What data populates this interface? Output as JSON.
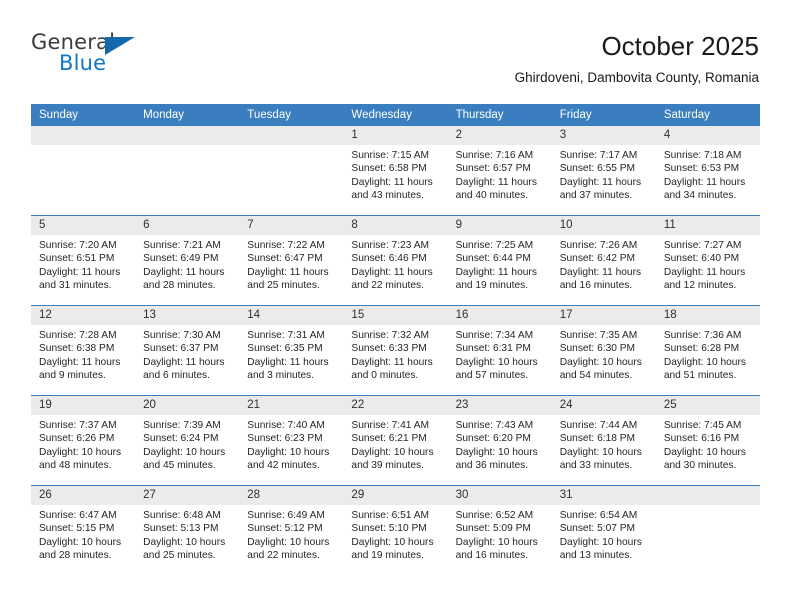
{
  "brand": {
    "line1": "General",
    "line2": "Blue",
    "triangle_icon": "brand-triangle-icon",
    "accent_color": "#1369ab"
  },
  "header": {
    "title": "October 2025",
    "subtitle": "Ghirdoveni, Dambovita County, Romania"
  },
  "theme": {
    "header_row_bg": "#3a7ec0",
    "daynum_bg": "#ebebeb",
    "row_divider": "#3a7ec0"
  },
  "weekday_headers": [
    "Sunday",
    "Monday",
    "Tuesday",
    "Wednesday",
    "Thursday",
    "Friday",
    "Saturday"
  ],
  "weeks": [
    [
      {
        "day": "",
        "sunrise": "",
        "sunset": "",
        "daylight_a": "",
        "daylight_b": ""
      },
      {
        "day": "",
        "sunrise": "",
        "sunset": "",
        "daylight_a": "",
        "daylight_b": ""
      },
      {
        "day": "",
        "sunrise": "",
        "sunset": "",
        "daylight_a": "",
        "daylight_b": ""
      },
      {
        "day": "1",
        "sunrise": "Sunrise: 7:15 AM",
        "sunset": "Sunset: 6:58 PM",
        "daylight_a": "Daylight: 11 hours",
        "daylight_b": "and 43 minutes."
      },
      {
        "day": "2",
        "sunrise": "Sunrise: 7:16 AM",
        "sunset": "Sunset: 6:57 PM",
        "daylight_a": "Daylight: 11 hours",
        "daylight_b": "and 40 minutes."
      },
      {
        "day": "3",
        "sunrise": "Sunrise: 7:17 AM",
        "sunset": "Sunset: 6:55 PM",
        "daylight_a": "Daylight: 11 hours",
        "daylight_b": "and 37 minutes."
      },
      {
        "day": "4",
        "sunrise": "Sunrise: 7:18 AM",
        "sunset": "Sunset: 6:53 PM",
        "daylight_a": "Daylight: 11 hours",
        "daylight_b": "and 34 minutes."
      }
    ],
    [
      {
        "day": "5",
        "sunrise": "Sunrise: 7:20 AM",
        "sunset": "Sunset: 6:51 PM",
        "daylight_a": "Daylight: 11 hours",
        "daylight_b": "and 31 minutes."
      },
      {
        "day": "6",
        "sunrise": "Sunrise: 7:21 AM",
        "sunset": "Sunset: 6:49 PM",
        "daylight_a": "Daylight: 11 hours",
        "daylight_b": "and 28 minutes."
      },
      {
        "day": "7",
        "sunrise": "Sunrise: 7:22 AM",
        "sunset": "Sunset: 6:47 PM",
        "daylight_a": "Daylight: 11 hours",
        "daylight_b": "and 25 minutes."
      },
      {
        "day": "8",
        "sunrise": "Sunrise: 7:23 AM",
        "sunset": "Sunset: 6:46 PM",
        "daylight_a": "Daylight: 11 hours",
        "daylight_b": "and 22 minutes."
      },
      {
        "day": "9",
        "sunrise": "Sunrise: 7:25 AM",
        "sunset": "Sunset: 6:44 PM",
        "daylight_a": "Daylight: 11 hours",
        "daylight_b": "and 19 minutes."
      },
      {
        "day": "10",
        "sunrise": "Sunrise: 7:26 AM",
        "sunset": "Sunset: 6:42 PM",
        "daylight_a": "Daylight: 11 hours",
        "daylight_b": "and 16 minutes."
      },
      {
        "day": "11",
        "sunrise": "Sunrise: 7:27 AM",
        "sunset": "Sunset: 6:40 PM",
        "daylight_a": "Daylight: 11 hours",
        "daylight_b": "and 12 minutes."
      }
    ],
    [
      {
        "day": "12",
        "sunrise": "Sunrise: 7:28 AM",
        "sunset": "Sunset: 6:38 PM",
        "daylight_a": "Daylight: 11 hours",
        "daylight_b": "and 9 minutes."
      },
      {
        "day": "13",
        "sunrise": "Sunrise: 7:30 AM",
        "sunset": "Sunset: 6:37 PM",
        "daylight_a": "Daylight: 11 hours",
        "daylight_b": "and 6 minutes."
      },
      {
        "day": "14",
        "sunrise": "Sunrise: 7:31 AM",
        "sunset": "Sunset: 6:35 PM",
        "daylight_a": "Daylight: 11 hours",
        "daylight_b": "and 3 minutes."
      },
      {
        "day": "15",
        "sunrise": "Sunrise: 7:32 AM",
        "sunset": "Sunset: 6:33 PM",
        "daylight_a": "Daylight: 11 hours",
        "daylight_b": "and 0 minutes."
      },
      {
        "day": "16",
        "sunrise": "Sunrise: 7:34 AM",
        "sunset": "Sunset: 6:31 PM",
        "daylight_a": "Daylight: 10 hours",
        "daylight_b": "and 57 minutes."
      },
      {
        "day": "17",
        "sunrise": "Sunrise: 7:35 AM",
        "sunset": "Sunset: 6:30 PM",
        "daylight_a": "Daylight: 10 hours",
        "daylight_b": "and 54 minutes."
      },
      {
        "day": "18",
        "sunrise": "Sunrise: 7:36 AM",
        "sunset": "Sunset: 6:28 PM",
        "daylight_a": "Daylight: 10 hours",
        "daylight_b": "and 51 minutes."
      }
    ],
    [
      {
        "day": "19",
        "sunrise": "Sunrise: 7:37 AM",
        "sunset": "Sunset: 6:26 PM",
        "daylight_a": "Daylight: 10 hours",
        "daylight_b": "and 48 minutes."
      },
      {
        "day": "20",
        "sunrise": "Sunrise: 7:39 AM",
        "sunset": "Sunset: 6:24 PM",
        "daylight_a": "Daylight: 10 hours",
        "daylight_b": "and 45 minutes."
      },
      {
        "day": "21",
        "sunrise": "Sunrise: 7:40 AM",
        "sunset": "Sunset: 6:23 PM",
        "daylight_a": "Daylight: 10 hours",
        "daylight_b": "and 42 minutes."
      },
      {
        "day": "22",
        "sunrise": "Sunrise: 7:41 AM",
        "sunset": "Sunset: 6:21 PM",
        "daylight_a": "Daylight: 10 hours",
        "daylight_b": "and 39 minutes."
      },
      {
        "day": "23",
        "sunrise": "Sunrise: 7:43 AM",
        "sunset": "Sunset: 6:20 PM",
        "daylight_a": "Daylight: 10 hours",
        "daylight_b": "and 36 minutes."
      },
      {
        "day": "24",
        "sunrise": "Sunrise: 7:44 AM",
        "sunset": "Sunset: 6:18 PM",
        "daylight_a": "Daylight: 10 hours",
        "daylight_b": "and 33 minutes."
      },
      {
        "day": "25",
        "sunrise": "Sunrise: 7:45 AM",
        "sunset": "Sunset: 6:16 PM",
        "daylight_a": "Daylight: 10 hours",
        "daylight_b": "and 30 minutes."
      }
    ],
    [
      {
        "day": "26",
        "sunrise": "Sunrise: 6:47 AM",
        "sunset": "Sunset: 5:15 PM",
        "daylight_a": "Daylight: 10 hours",
        "daylight_b": "and 28 minutes."
      },
      {
        "day": "27",
        "sunrise": "Sunrise: 6:48 AM",
        "sunset": "Sunset: 5:13 PM",
        "daylight_a": "Daylight: 10 hours",
        "daylight_b": "and 25 minutes."
      },
      {
        "day": "28",
        "sunrise": "Sunrise: 6:49 AM",
        "sunset": "Sunset: 5:12 PM",
        "daylight_a": "Daylight: 10 hours",
        "daylight_b": "and 22 minutes."
      },
      {
        "day": "29",
        "sunrise": "Sunrise: 6:51 AM",
        "sunset": "Sunset: 5:10 PM",
        "daylight_a": "Daylight: 10 hours",
        "daylight_b": "and 19 minutes."
      },
      {
        "day": "30",
        "sunrise": "Sunrise: 6:52 AM",
        "sunset": "Sunset: 5:09 PM",
        "daylight_a": "Daylight: 10 hours",
        "daylight_b": "and 16 minutes."
      },
      {
        "day": "31",
        "sunrise": "Sunrise: 6:54 AM",
        "sunset": "Sunset: 5:07 PM",
        "daylight_a": "Daylight: 10 hours",
        "daylight_b": "and 13 minutes."
      },
      {
        "day": "",
        "sunrise": "",
        "sunset": "",
        "daylight_a": "",
        "daylight_b": ""
      }
    ]
  ]
}
